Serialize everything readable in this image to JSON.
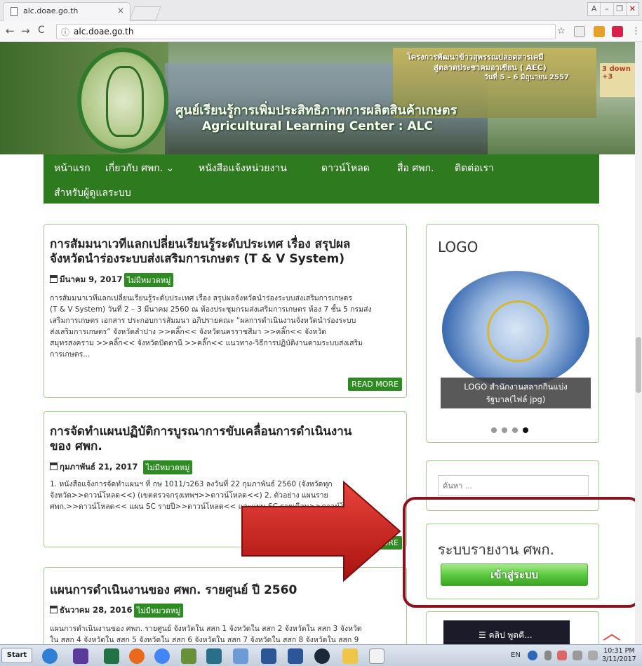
{
  "browser": {
    "tab_title": "alc.doae.go.th",
    "tab_close": "×",
    "url": "alc.doae.go.th",
    "info_icon": "ⓘ",
    "back": "←",
    "forward": "→",
    "reload": "C",
    "star": "☆",
    "menu": "⋮",
    "window_buttons": [
      "A",
      "–",
      "❐",
      "✕"
    ]
  },
  "banner": {
    "thai_title": "ศูนย์เรียนรู้การเพิ่มประสิทธิภาพการผลิตสินค้าเกษตร",
    "en_title": "Agricultural Learning Center  : ALC",
    "line1": "โครงการพัฒนาข้าวสุพรรณปลอดสารเคมี",
    "line2": "สู่ตลาดประชาคมอาเซียน ( AEC)",
    "line3": "วันที่ 5 – 6 มิถุนายน 2557",
    "side_text": "3 down +3"
  },
  "menu": {
    "items": [
      "หน้าแรก",
      "เกี่ยวกับ ศพก. ⌄",
      "หนังสือแจ้งหน่วยงาน",
      "ดาวน์โหลด",
      "สื่อ ศพก.",
      "ติดต่อเรา"
    ],
    "second_row": "สำหรับผู้ดูแลระบบ"
  },
  "posts": [
    {
      "title_line1": "การสัมมนาเวทีแลกเปลี่ยนเรียนรู้ระดับประเทศ เรื่อง สรุปผล",
      "title_line2": "จังหวัดนำร่องระบบส่งเสริมการเกษตร (T & V System)",
      "date": "มีนาคม 9, 2017",
      "category": "ไม่มีหมวดหมู่",
      "excerpt": [
        "การสัมมนาเวทีแลกเปลี่ยนเรียนรู้ระดับประเทศ เรื่อง  สรุปผลจังหวัดนำร่องระบบส่งเสริมการเกษตร",
        "(T & V System) วันที่ 2 – 3 มีนาคม 2560 ณ ห้องประชุมกรมส่งเสริมการเกษตร ห้อง 7 ชั้น 5 กรมส่ง",
        "เสริมการเกษตร  เอกสาร ประกอบการสัมมนา อภิปรายคณะ “ผลการดำเนินงานจังหวัดนำร่องระบบ",
        "ส่งเสริมการเกษตร” จังหวัดลำปาง >>คลิ๊ก<< จังหวัดนครราชสีมา >>คลิ๊ก<< จังหวัด",
        "สมุทรสงคราม >>คลิ๊ก<< จังหวัดปัตตานี >>คลิ๊ก<< แนวทาง-วิธีการปฏิบัติงานตามระบบส่งเสริม",
        "การเกษตร..."
      ],
      "read_more": "READ MORE"
    },
    {
      "title_line1": "การจัดทำแผนปฏิบัติการบูรณาการขับเคลื่อนการดำเนินงาน",
      "title_line2": "ของ ศพก.",
      "date": "กุมภาพันธ์ 21, 2017",
      "category": "ไม่มีหมวดหมู่",
      "excerpt": [
        "1. หนังสือแจ้งการจัดทำแผนฯ ที่ กษ 1011/ว263  ลงวันที่ 22 กุมภาพันธ์ 2560 (จังหวัดทุก",
        "จังหวัด>>ดาวน์โหลด<<)  (เขตตรวจกรุงเทพฯ>>ดาวน์โหลด<<)    2. ตัวอย่าง แผนราย",
        "ศพก.>>ดาวน์โหลด<<    แผน SC รายปี>>ดาวน์โหลด<< และแผน SC รายเดือน>>ดาวน์โหลด<<"
      ],
      "read_more": "ORE"
    },
    {
      "title_line1": "แผนการดำเนินงานของ ศพก. รายศูนย์ ปี 2560",
      "date": "ธันวาคม 28, 2016",
      "category": "ไม่มีหมวดหมู่",
      "excerpt": [
        "แผนการดำเนินงานของ ศพก. รายศูนย์ จังหวัดใน สสก 1 จังหวัดใน สสก 2 จังหวัดใน สสก 3 จังหวัด",
        "ใน สสก 4 จังหวัดใน สสก 5 จังหวัดใน สสก 6 จังหวัดใน สสก 7 จังหวัดใน สสก 8 จังหวัดใน สสก 9"
      ]
    }
  ],
  "sidebar": {
    "logo_title": "LOGO",
    "logo_caption_line1": "LOGO สำนักงานสลากกินแบ่ง",
    "logo_caption_line2": "รัฐบาล(ไฟล์ jpg)",
    "search_placeholder": "ค้นหา ...",
    "report_title": "ระบบรายงาน ศพก.",
    "login_button": "เข้าสู่ระบบ",
    "video_label": "☰ คลิป พูดคี..."
  },
  "taskbar": {
    "start": "Start",
    "lang": "EN",
    "time": "10:31 PM",
    "date": "3/11/2017"
  },
  "colors": {
    "menu_green": "#2e7a1f",
    "badge_green": "#2e8b23",
    "annotation_red": "#8b1220",
    "arrow_red": "#d0201c"
  }
}
